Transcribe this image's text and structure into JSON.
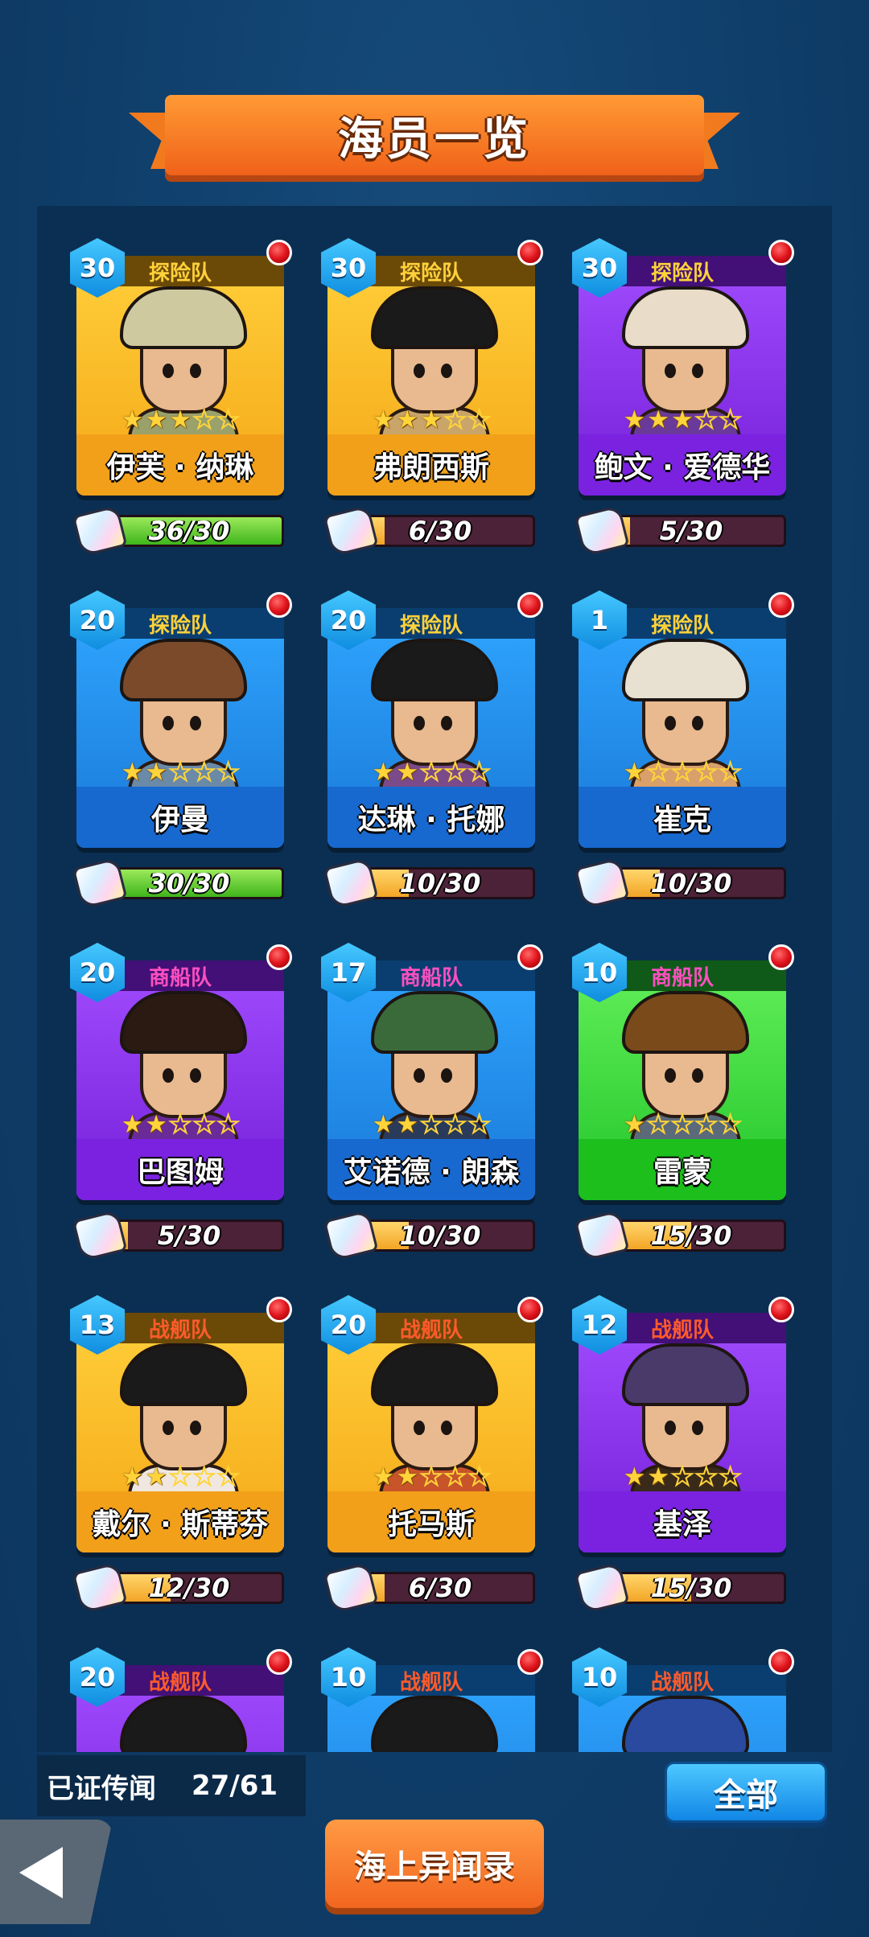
{
  "title": "海员一览",
  "crew": [
    {
      "level": "30",
      "faction": "探险队",
      "name": "伊芙 · 纳琳",
      "stars": 3,
      "progress": "36/30",
      "ratio": 1.0,
      "theme": "yellow",
      "factionColor": "#ffd13a",
      "hatColor": "#cfc9a0",
      "bodyColor": "#9aa16a"
    },
    {
      "level": "30",
      "faction": "探险队",
      "name": "弗朗西斯",
      "stars": 3,
      "progress": "6/30",
      "ratio": 0.2,
      "theme": "yellow",
      "factionColor": "#ffd13a",
      "hatColor": "#1a1a1a",
      "bodyColor": "#c9a56a"
    },
    {
      "level": "30",
      "faction": "探险队",
      "name": "鲍文 · 爱德华",
      "stars": 3,
      "progress": "5/30",
      "ratio": 0.17,
      "theme": "purple",
      "factionColor": "#ffd13a",
      "hatColor": "#e9dcc8",
      "bodyColor": "#6a3a9a"
    },
    {
      "level": "20",
      "faction": "探险队",
      "name": "伊曼",
      "stars": 2,
      "progress": "30/30",
      "ratio": 1.0,
      "theme": "blue",
      "factionColor": "#ffd13a",
      "hatColor": "#7a4a2a",
      "bodyColor": "#6a8aa8"
    },
    {
      "level": "20",
      "faction": "探险队",
      "name": "达琳 · 托娜",
      "stars": 2,
      "progress": "10/30",
      "ratio": 0.33,
      "theme": "blue",
      "factionColor": "#ffd13a",
      "hatColor": "#1a1a1a",
      "bodyColor": "#7a4a8a"
    },
    {
      "level": "1",
      "faction": "探险队",
      "name": "崔克",
      "stars": 1,
      "progress": "10/30",
      "ratio": 0.33,
      "theme": "blue",
      "factionColor": "#ffd13a",
      "hatColor": "#e8e0d0",
      "bodyColor": "#d9a06a"
    },
    {
      "level": "20",
      "faction": "商船队",
      "name": "巴图姆",
      "stars": 2,
      "progress": "5/30",
      "ratio": 0.17,
      "theme": "purple",
      "factionColor": "#ff4fc0",
      "hatColor": "#2a1a12",
      "bodyColor": "#6a2a9a"
    },
    {
      "level": "17",
      "faction": "商船队",
      "name": "艾诺德 · 朗森",
      "stars": 2,
      "progress": "10/30",
      "ratio": 0.33,
      "theme": "blue",
      "factionColor": "#ff4fc0",
      "hatColor": "#3a6a3a",
      "bodyColor": "#2a3a5a"
    },
    {
      "level": "10",
      "faction": "商船队",
      "name": "雷蒙",
      "stars": 1,
      "progress": "15/30",
      "ratio": 0.5,
      "theme": "green",
      "factionColor": "#ff4fc0",
      "hatColor": "#7a4a1a",
      "bodyColor": "#5a6a7a"
    },
    {
      "level": "13",
      "faction": "战舰队",
      "name": "戴尔 · 斯蒂芬",
      "stars": 2,
      "progress": "12/30",
      "ratio": 0.4,
      "theme": "yellow",
      "factionColor": "#ff5a2a",
      "hatColor": "#1a1a1a",
      "bodyColor": "#f0e8e0"
    },
    {
      "level": "20",
      "faction": "战舰队",
      "name": "托马斯",
      "stars": 2,
      "progress": "6/30",
      "ratio": 0.2,
      "theme": "yellow",
      "factionColor": "#ff5a2a",
      "hatColor": "#1a1a1a",
      "bodyColor": "#c8542a"
    },
    {
      "level": "12",
      "faction": "战舰队",
      "name": "基泽",
      "stars": 2,
      "progress": "15/30",
      "ratio": 0.5,
      "theme": "purple",
      "factionColor": "#ff5a2a",
      "hatColor": "#4a3a6a",
      "bodyColor": "#3a2a1a"
    },
    {
      "level": "20",
      "faction": "战舰队",
      "name": "",
      "stars": 0,
      "progress": "",
      "ratio": 0,
      "theme": "purple",
      "factionColor": "#ff5a2a",
      "hatColor": "#1a1a1a",
      "bodyColor": "#6a2a9a"
    },
    {
      "level": "10",
      "faction": "战舰队",
      "name": "",
      "stars": 0,
      "progress": "",
      "ratio": 0,
      "theme": "blue",
      "factionColor": "#ff5a2a",
      "hatColor": "#1a1a1a",
      "bodyColor": "#2a3a5a"
    },
    {
      "level": "10",
      "faction": "战舰队",
      "name": "",
      "stars": 0,
      "progress": "",
      "ratio": 0,
      "theme": "blue",
      "factionColor": "#ff5a2a",
      "hatColor": "#2a4aa0",
      "bodyColor": "#2a3a5a"
    }
  ],
  "footer": {
    "collected_label": "已证传闻",
    "collected_count": "27/61",
    "all_button": "全部",
    "sea_button": "海上异闻录",
    "back_icon": "back-arrow-icon",
    "puzzle_icon": "puzzle-piece-icon",
    "alert_icon": "red-dot-icon"
  }
}
